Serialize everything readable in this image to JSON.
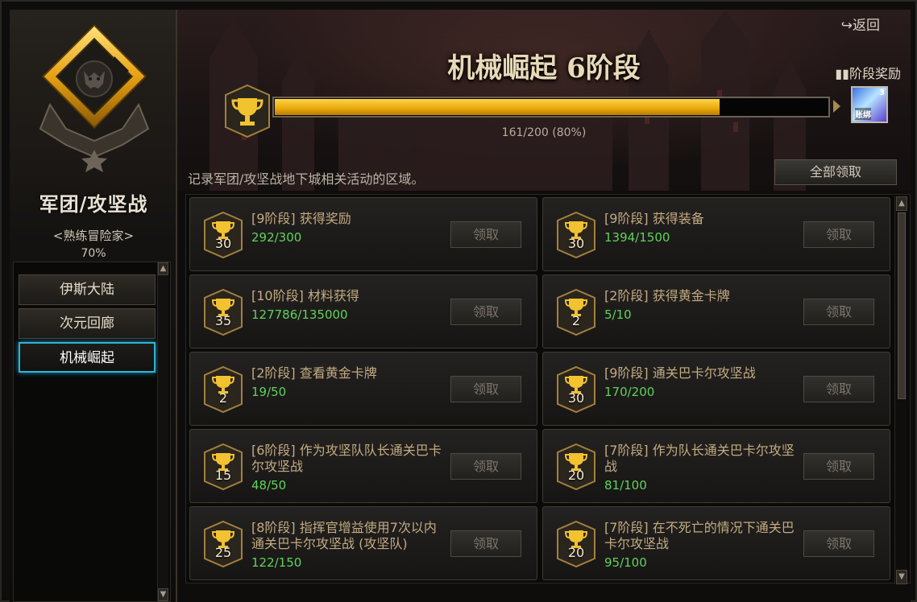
{
  "header": {
    "back_label": "返回",
    "stage_title": "机械崛起 6阶段",
    "reward_label": "阶段奖励",
    "reward_count": "3",
    "reward_tag": "账绑"
  },
  "progress": {
    "current": 161,
    "max": 200,
    "fraction": 0.805,
    "text": "161/200 (80%)"
  },
  "profile": {
    "title": "军团/攻坚战",
    "subtitle": "<熟练冒险家>",
    "percent": "70%"
  },
  "sidebar": {
    "items": [
      {
        "label": "伊斯大陆",
        "active": false
      },
      {
        "label": "次元回廊",
        "active": false
      },
      {
        "label": "机械崛起",
        "active": true
      }
    ]
  },
  "main": {
    "description": "记录军团/攻坚战地下城相关活动的区域。",
    "claim_all_label": "全部领取"
  },
  "tasks": [
    {
      "points": "30",
      "title": "[9阶段] 获得奖励",
      "progress": "292/300",
      "claim": "领取"
    },
    {
      "points": "30",
      "title": "[9阶段] 获得装备",
      "progress": "1394/1500",
      "claim": "领取"
    },
    {
      "points": "35",
      "title": "[10阶段] 材料获得",
      "progress": "127786/135000",
      "claim": "领取"
    },
    {
      "points": "2",
      "title": "[2阶段] 获得黄金卡牌",
      "progress": "5/10",
      "claim": "领取"
    },
    {
      "points": "2",
      "title": "[2阶段] 查看黄金卡牌",
      "progress": "19/50",
      "claim": "领取"
    },
    {
      "points": "30",
      "title": "[9阶段] 通关巴卡尔攻坚战",
      "progress": "170/200",
      "claim": "领取"
    },
    {
      "points": "15",
      "title": "[6阶段] 作为攻坚队队长通关巴卡尔攻坚战",
      "progress": "48/50",
      "claim": "领取"
    },
    {
      "points": "20",
      "title": "[7阶段] 作为队长通关巴卡尔攻坚战",
      "progress": "81/100",
      "claim": "领取"
    },
    {
      "points": "25",
      "title": "[8阶段] 指挥官增益使用7次以内通关巴卡尔攻坚战 (攻坚队)",
      "progress": "122/150",
      "claim": "领取"
    },
    {
      "points": "20",
      "title": "[7阶段] 在不死亡的情况下通关巴卡尔攻坚战",
      "progress": "95/100",
      "claim": "领取"
    }
  ],
  "colors": {
    "accent_gold": "#e8a90a",
    "progress_green": "#5fd35a",
    "active_border": "#2fb3d6",
    "task_title": "#c3ab82"
  },
  "icons": {
    "back": "back-arrow-icon",
    "reward": "gift-icon",
    "trophy": "trophy-icon",
    "emblem": "guild-emblem-icon"
  }
}
